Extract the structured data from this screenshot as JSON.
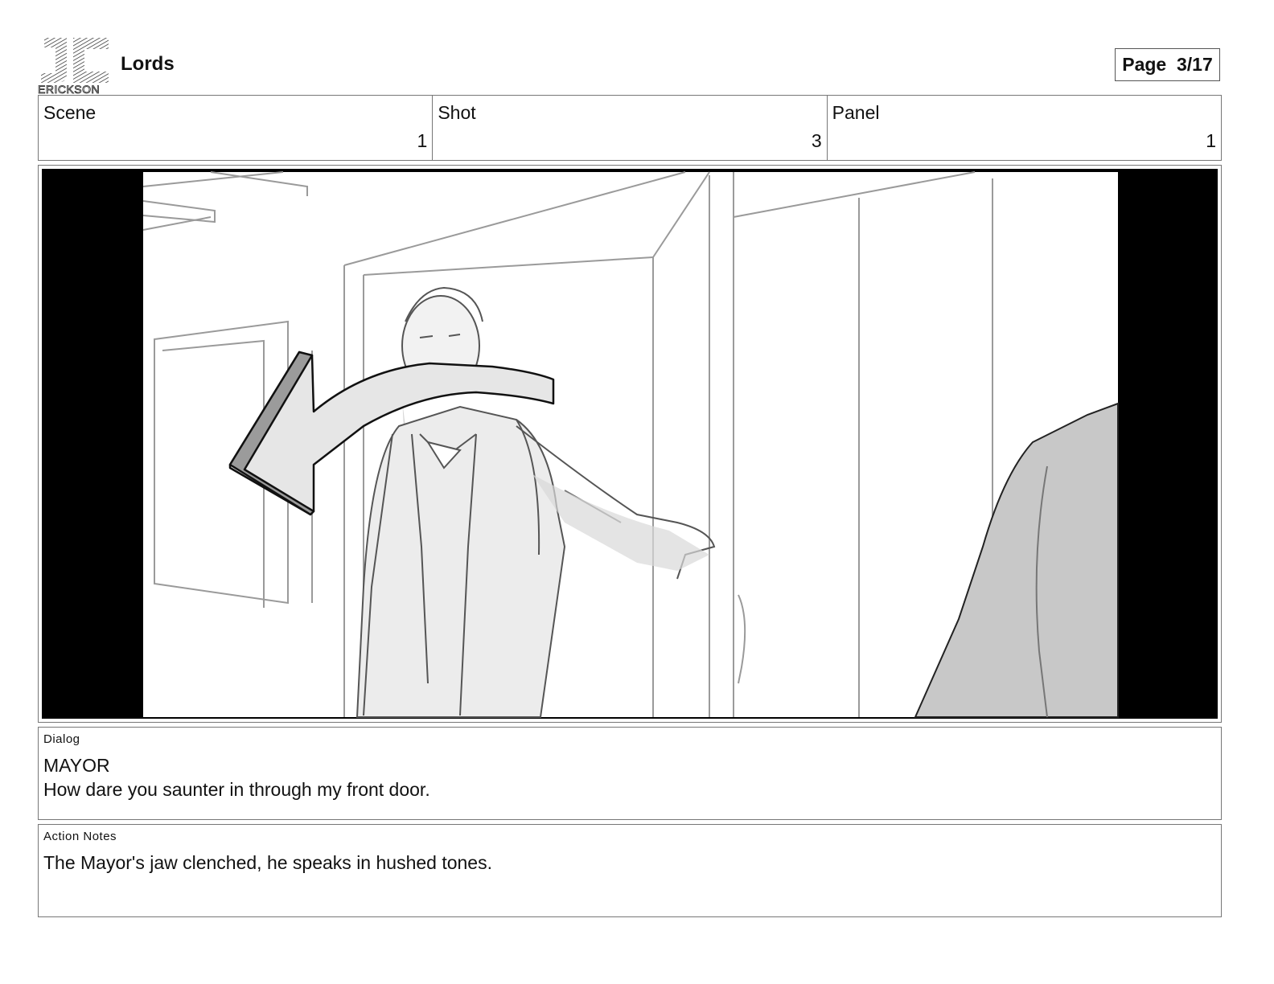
{
  "header": {
    "logo_text": "ERICKSON",
    "title": "Lords",
    "page_label": "Page  3/17"
  },
  "info": {
    "scene_label": "Scene",
    "scene_value": "1",
    "shot_label": "Shot",
    "shot_value": "3",
    "panel_label": "Panel",
    "panel_value": "1"
  },
  "dialog": {
    "label": "Dialog",
    "character": "MAYOR",
    "line": "How dare you saunter in through my front door."
  },
  "action_notes": {
    "label": "Action Notes",
    "text": "The Mayor's jaw clenched, he speaks in hushed tones."
  }
}
